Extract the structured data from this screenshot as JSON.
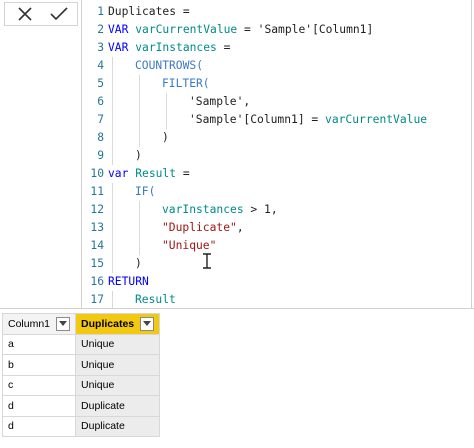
{
  "formula_bar": {
    "cancel_icon": "close-icon",
    "confirm_icon": "check-icon",
    "lines": [
      {
        "n": "1",
        "indent": 0,
        "parts": [
          {
            "t": "Duplicates =",
            "c": ""
          }
        ]
      },
      {
        "n": "2",
        "indent": 0,
        "parts": [
          {
            "t": "VAR ",
            "c": "kw"
          },
          {
            "t": "varCurrentValue",
            "c": "var"
          },
          {
            "t": " = 'Sample'[Column1]",
            "c": ""
          }
        ]
      },
      {
        "n": "3",
        "indent": 0,
        "parts": [
          {
            "t": "VAR ",
            "c": "kw"
          },
          {
            "t": "varInstances",
            "c": "var"
          },
          {
            "t": " =",
            "c": ""
          }
        ]
      },
      {
        "n": "4",
        "indent": 1,
        "parts": [
          {
            "t": "COUNTROWS(",
            "c": "fn"
          }
        ]
      },
      {
        "n": "5",
        "indent": 2,
        "parts": [
          {
            "t": "FILTER(",
            "c": "fn"
          }
        ]
      },
      {
        "n": "6",
        "indent": 3,
        "parts": [
          {
            "t": "'Sample',",
            "c": ""
          }
        ]
      },
      {
        "n": "7",
        "indent": 3,
        "parts": [
          {
            "t": "'Sample'[Column1] = ",
            "c": ""
          },
          {
            "t": "varCurrentValue",
            "c": "var"
          }
        ]
      },
      {
        "n": "8",
        "indent": 2,
        "parts": [
          {
            "t": ")",
            "c": ""
          }
        ]
      },
      {
        "n": "9",
        "indent": 1,
        "parts": [
          {
            "t": ")",
            "c": ""
          }
        ]
      },
      {
        "n": "10",
        "indent": 0,
        "parts": [
          {
            "t": "var ",
            "c": "kw"
          },
          {
            "t": "Result",
            "c": "var"
          },
          {
            "t": " =",
            "c": ""
          }
        ]
      },
      {
        "n": "11",
        "indent": 1,
        "parts": [
          {
            "t": "IF(",
            "c": "fn"
          }
        ]
      },
      {
        "n": "12",
        "indent": 2,
        "parts": [
          {
            "t": "varInstances",
            "c": "var"
          },
          {
            "t": " > 1,",
            "c": ""
          }
        ]
      },
      {
        "n": "13",
        "indent": 2,
        "parts": [
          {
            "t": "\"Duplicate\"",
            "c": "str"
          },
          {
            "t": ",",
            "c": ""
          }
        ]
      },
      {
        "n": "14",
        "indent": 2,
        "parts": [
          {
            "t": "\"Unique\"",
            "c": "str"
          }
        ]
      },
      {
        "n": "15",
        "indent": 1,
        "parts": [
          {
            "t": ")",
            "c": ""
          }
        ]
      },
      {
        "n": "16",
        "indent": 0,
        "parts": [
          {
            "t": "RETURN",
            "c": "kw"
          }
        ]
      },
      {
        "n": "17",
        "indent": 1,
        "parts": [
          {
            "t": "Result",
            "c": "var"
          }
        ]
      }
    ]
  },
  "table": {
    "columns": [
      {
        "label": "Column1",
        "selected": false
      },
      {
        "label": "Duplicates",
        "selected": true
      }
    ],
    "rows": [
      [
        "a",
        "Unique"
      ],
      [
        "b",
        "Unique"
      ],
      [
        "c",
        "Unique"
      ],
      [
        "d",
        "Duplicate"
      ],
      [
        "d",
        "Duplicate"
      ]
    ]
  },
  "colors": {
    "accent": "#f2c811",
    "keyword": "#0000ff",
    "function": "#3a79c8",
    "variable": "#008a8a",
    "string": "#a31515",
    "line_number": "#237893"
  }
}
